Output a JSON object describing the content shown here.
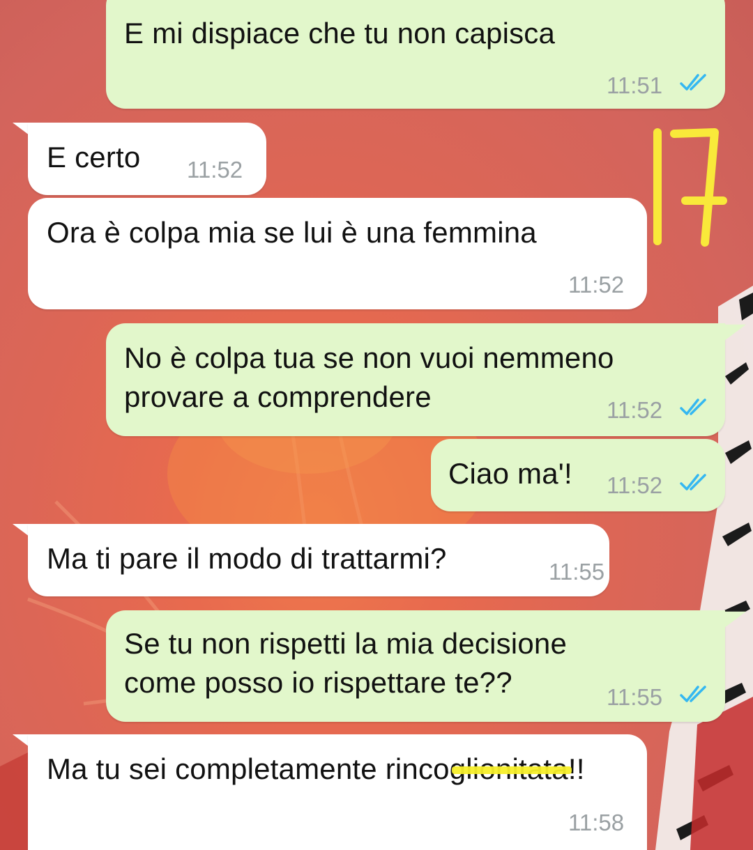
{
  "messages": [
    {
      "id": "m1",
      "direction": "out",
      "text": "E mi dispiace che tu non capisca",
      "time": "11:51",
      "status": "read"
    },
    {
      "id": "m2",
      "direction": "in",
      "text": "E certo",
      "time": "11:52"
    },
    {
      "id": "m3",
      "direction": "in",
      "text": "Ora è colpa mia se lui è una femmina",
      "time": "11:52"
    },
    {
      "id": "m4",
      "direction": "out",
      "line1": "No è colpa tua se non vuoi nemmeno",
      "line2": "provare a comprendere",
      "time": "11:52",
      "status": "read"
    },
    {
      "id": "m5",
      "direction": "out",
      "text": "Ciao ma'!",
      "time": "11:52",
      "status": "read"
    },
    {
      "id": "m6",
      "direction": "in",
      "text": "Ma ti pare il modo di trattarmi?",
      "time": "11:55"
    },
    {
      "id": "m7",
      "direction": "out",
      "line1": "Se tu non rispetti la mia decisione",
      "line2": "come posso io rispettare te??",
      "time": "11:55",
      "status": "read"
    },
    {
      "id": "m8",
      "direction": "in",
      "text_start": "Ma tu sei completamente ri",
      "text_hidden": "ncoglionita",
      "text_end": "ta!!",
      "time": "11:58",
      "redacted": true
    }
  ],
  "annotation": {
    "text": "17",
    "color": "#f9e93a"
  },
  "colors": {
    "outgoing_bubble": "#e2f7cb",
    "incoming_bubble": "#ffffff",
    "read_ticks": "#34b7f1",
    "timestamp": "#9aa0a3"
  },
  "icons": [
    "double-check-icon"
  ]
}
